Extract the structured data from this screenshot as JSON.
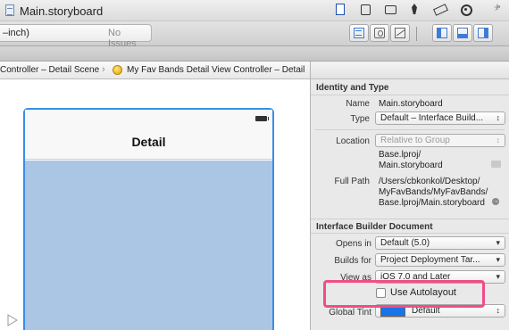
{
  "window": {
    "title": "Main.storyboard"
  },
  "toolbar": {
    "scheme": "–inch)",
    "status": "No Issues"
  },
  "jump_bar": {
    "crumb_1": "Controller – Detail Scene",
    "separator": "›",
    "crumb_2": "My Fav Bands Detail View Controller – Detail"
  },
  "canvas": {
    "nav_title": "Detail",
    "colors": {
      "selection": "#3a8ee6",
      "content_view": "#abc5e5"
    }
  },
  "inspector": {
    "identity_and_type": {
      "header": "Identity and Type",
      "name_label": "Name",
      "name_value": "Main.storyboard",
      "type_label": "Type",
      "type_value": "Default – Interface Build...",
      "location_label": "Location",
      "location_value": "Relative to Group",
      "relative_path_line1": "Base.lproj/",
      "relative_path_line2": "Main.storyboard",
      "full_path_label": "Full Path",
      "full_path_line1": "/Users/cbkonkol/Desktop/",
      "full_path_line2": "MyFavBands/MyFavBands/",
      "full_path_line3": "Base.lproj/Main.storyboard"
    },
    "ib_document": {
      "header": "Interface Builder Document",
      "opens_in_label": "Opens in",
      "opens_in_value": "Default (5.0)",
      "builds_for_label": "Builds for",
      "builds_for_value": "Project Deployment Tar...",
      "view_as_label": "View as",
      "view_as_value": "iOS 7.0 and Later",
      "autolayout_label": "Use Autolayout",
      "autolayout_checked": false,
      "global_tint_label": "Global Tint",
      "global_tint_value": "Default",
      "global_tint_color": "#1a73e8"
    },
    "highlight_color": "#f04d87"
  },
  "glyphs": {
    "popup_arrow_updown": "↕",
    "popup_arrow_down": "▾",
    "plus": "+",
    "fullscreen": "↗",
    "path_arrow": "→"
  }
}
